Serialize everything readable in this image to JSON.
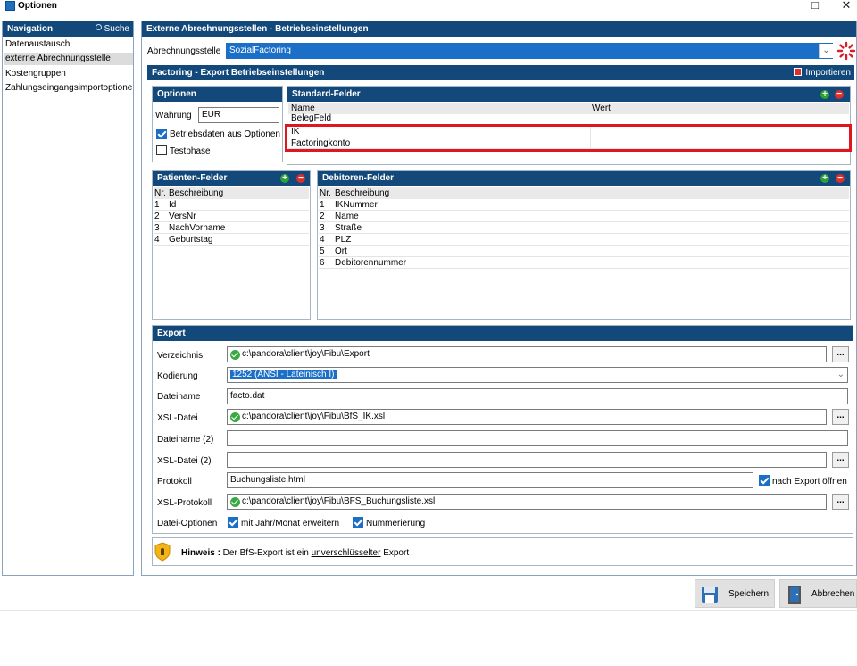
{
  "window": {
    "title": "Optionen",
    "maximize_icon": "□",
    "close_icon": "✕"
  },
  "nav": {
    "title": "Navigation",
    "search_label": "Suche",
    "items": [
      "Datenaustausch",
      "externe Abrechnungsstelle",
      "Kostengruppen",
      "Zahlungseingangsimportoptionen"
    ],
    "selected_index": 1
  },
  "main": {
    "title": "Externe Abrechnungsstellen - Betriebseinstellungen",
    "abrechnungsstelle_label": "Abrechnungsstelle",
    "abrechnungsstelle_value": "SozialFactoring",
    "factoring_title": "Factoring - Export Betriebseinstellungen",
    "import_label": "Importieren",
    "optionen": {
      "title": "Optionen",
      "waehrung_label": "Währung",
      "waehrung_value": "EUR",
      "betriebsdaten_label": "Betriebsdaten aus Optionen",
      "betriebsdaten_checked": true,
      "testphase_label": "Testphase",
      "testphase_checked": false
    },
    "standard": {
      "title": "Standard-Felder",
      "col_name": "Name",
      "col_wert": "Wert",
      "rows": [
        {
          "name": "BelegFeld",
          "wert": ""
        },
        {
          "name": "IK",
          "wert": ""
        },
        {
          "name": "Factoringkonto",
          "wert": ""
        }
      ]
    },
    "patienten": {
      "title": "Patienten-Felder",
      "col_nr": "Nr.",
      "col_desc": "Beschreibung",
      "rows": [
        {
          "nr": "1",
          "desc": "Id"
        },
        {
          "nr": "2",
          "desc": "VersNr"
        },
        {
          "nr": "3",
          "desc": "NachVorname"
        },
        {
          "nr": "4",
          "desc": "Geburtstag"
        }
      ]
    },
    "debitoren": {
      "title": "Debitoren-Felder",
      "col_nr": "Nr.",
      "col_desc": "Beschreibung",
      "rows": [
        {
          "nr": "1",
          "desc": "IKNummer"
        },
        {
          "nr": "2",
          "desc": "Name"
        },
        {
          "nr": "3",
          "desc": "Straße"
        },
        {
          "nr": "4",
          "desc": "PLZ"
        },
        {
          "nr": "5",
          "desc": "Ort"
        },
        {
          "nr": "6",
          "desc": "Debitorennummer"
        }
      ]
    },
    "export": {
      "title": "Export",
      "verzeichnis_label": "Verzeichnis",
      "verzeichnis_value": "c:\\pandora\\client\\joy\\Fibu\\Export",
      "kodierung_label": "Kodierung",
      "kodierung_value": "1252  (ANSI - Lateinisch I)",
      "dateiname_label": "Dateiname",
      "dateiname_value": "facto.dat",
      "xsl_label": "XSL-Datei",
      "xsl_value": "c:\\pandora\\client\\joy\\Fibu\\BfS_IK.xsl",
      "dateiname2_label": "Dateiname (2)",
      "dateiname2_value": "",
      "xsl2_label": "XSL-Datei (2)",
      "xsl2_value": "",
      "protokoll_label": "Protokoll",
      "protokoll_value": "Buchungsliste.html",
      "nach_export_label": "nach Export öffnen",
      "nach_export_checked": true,
      "xslprot_label": "XSL-Protokoll",
      "xslprot_value": "c:\\pandora\\client\\joy\\Fibu\\BFS_Buchungsliste.xsl",
      "dateioptionen_label": "Datei-Optionen",
      "jahr_monat_label": "mit Jahr/Monat erweitern",
      "jahr_monat_checked": true,
      "nummerierung_label": "Nummerierung",
      "nummerierung_checked": true,
      "browse_label": "..."
    },
    "hinweis": {
      "prefix": "Hinweis :",
      "text1": " Der BfS-Export ist ein ",
      "underlined": "unverschlüsselter",
      "text2": " Export"
    }
  },
  "buttons": {
    "save_label": "Speichern",
    "cancel_label": "Abbrechen"
  },
  "colors": {
    "header_bg": "#12487a",
    "selection": "#1c6fc7",
    "highlight_border": "#e0161f"
  }
}
